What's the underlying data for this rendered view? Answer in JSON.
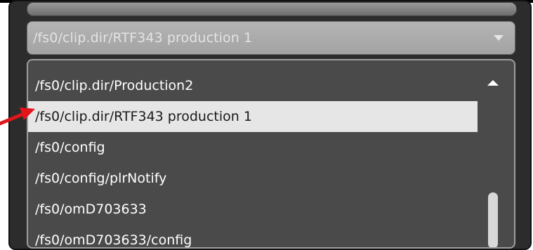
{
  "combo": {
    "selected_value": "/fs0/clip.dir/RTF343 production 1"
  },
  "dropdown": {
    "items": [
      {
        "label": "/fs0/clip.dir/Production2"
      },
      {
        "label": "/fs0/clip.dir/RTF343 production 1"
      },
      {
        "label": "/fs0/config"
      },
      {
        "label": "/fs0/config/plrNotify"
      },
      {
        "label": "/fs0/omD703633"
      },
      {
        "label": "/fs0/omD703633/config"
      }
    ],
    "selected_index": 1
  },
  "colors": {
    "panel_bg": "#2c2c2c",
    "list_bg": "#4a4a4a",
    "selected_bg": "#e6e6e6",
    "annotation_arrow": "#e0161b"
  },
  "icons": {
    "combo_arrow": "chevron-down-icon",
    "scroll_up": "scroll-up-arrow-icon",
    "annotation": "red-arrow-icon"
  }
}
